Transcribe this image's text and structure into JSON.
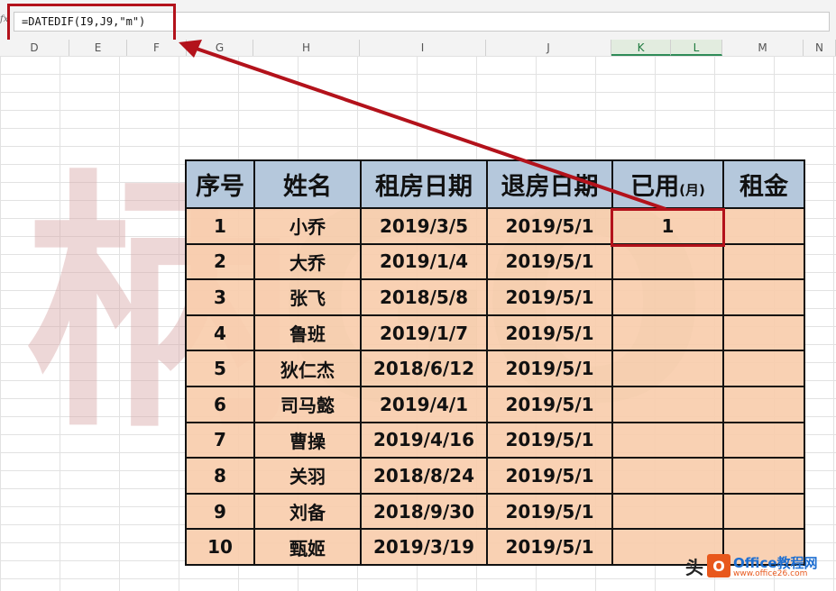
{
  "formula_bar": {
    "fx_label": "fx",
    "formula": "=DATEDIF(I9,J9,\"m\")"
  },
  "columns": [
    "D",
    "E",
    "F",
    "G",
    "H",
    "I",
    "J",
    "K",
    "L",
    "M",
    "N"
  ],
  "selected_columns": [
    "K",
    "L"
  ],
  "table": {
    "headers": [
      "序号",
      "姓名",
      "租房日期",
      "退房日期",
      "已用",
      "租金"
    ],
    "unit_suffix": "(月)",
    "rows": [
      [
        "1",
        "小乔",
        "2019/3/5",
        "2019/5/1",
        "1",
        ""
      ],
      [
        "2",
        "大乔",
        "2019/1/4",
        "2019/5/1",
        "",
        ""
      ],
      [
        "3",
        "张飞",
        "2018/5/8",
        "2019/5/1",
        "",
        ""
      ],
      [
        "4",
        "鲁班",
        "2019/1/7",
        "2019/5/1",
        "",
        ""
      ],
      [
        "5",
        "狄仁杰",
        "2018/6/12",
        "2019/5/1",
        "",
        ""
      ],
      [
        "6",
        "司马懿",
        "2019/4/1",
        "2019/5/1",
        "",
        ""
      ],
      [
        "7",
        "曹操",
        "2019/4/16",
        "2019/5/1",
        "",
        ""
      ],
      [
        "8",
        "关羽",
        "2018/8/24",
        "2019/5/1",
        "",
        ""
      ],
      [
        "9",
        "刘备",
        "2018/9/30",
        "2019/5/1",
        "",
        ""
      ],
      [
        "10",
        "甄姬",
        "2019/3/19",
        "2019/5/1",
        "",
        ""
      ]
    ]
  },
  "watermark": {
    "char": "柄",
    "letters": "GO"
  },
  "logo": {
    "prefix": "头",
    "badge": "O",
    "text": "Office教程网",
    "url": "www.office26.com"
  },
  "colors": {
    "highlight": "#b3121b",
    "header_bg": "#b5c8dc",
    "row_bg": "#f8cdac"
  }
}
